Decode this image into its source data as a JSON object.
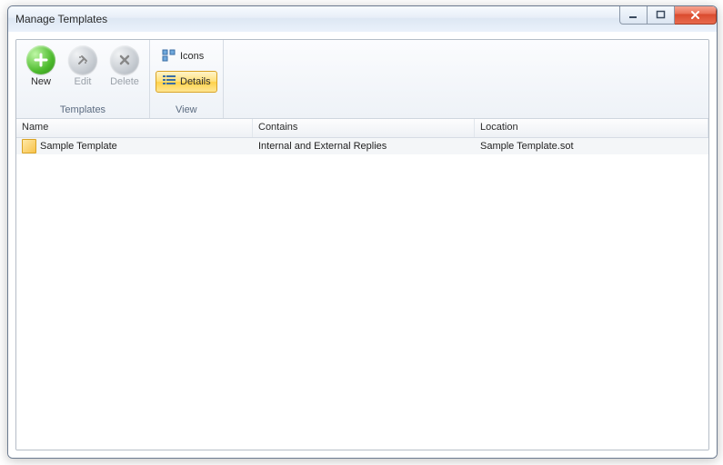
{
  "window": {
    "title": "Manage Templates"
  },
  "ribbon": {
    "templates_group_label": "Templates",
    "view_group_label": "View",
    "new_label": "New",
    "edit_label": "Edit",
    "delete_label": "Delete",
    "icons_label": "Icons",
    "details_label": "Details"
  },
  "columns": {
    "name": "Name",
    "contains": "Contains",
    "location": "Location"
  },
  "rows": [
    {
      "name": "Sample Template",
      "contains": "Internal and External Replies",
      "location": "Sample Template.sot"
    }
  ]
}
